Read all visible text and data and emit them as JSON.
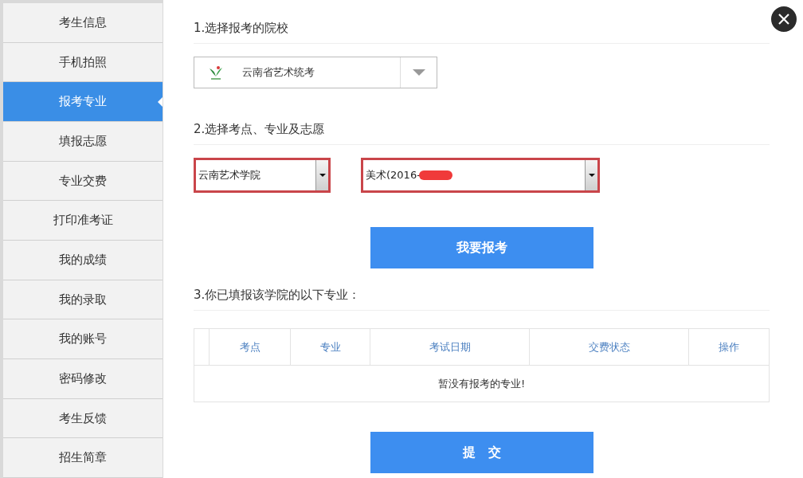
{
  "sidebar": {
    "items": [
      {
        "label": "考生信息",
        "selected": false
      },
      {
        "label": "手机拍照",
        "selected": false
      },
      {
        "label": "报考专业",
        "selected": true
      },
      {
        "label": "填报志愿",
        "selected": false
      },
      {
        "label": "专业交费",
        "selected": false
      },
      {
        "label": "打印准考证",
        "selected": false
      },
      {
        "label": "我的成绩",
        "selected": false
      },
      {
        "label": "我的录取",
        "selected": false
      },
      {
        "label": "我的账号",
        "selected": false
      },
      {
        "label": "密码修改",
        "selected": false
      },
      {
        "label": "考生反馈",
        "selected": false
      },
      {
        "label": "招生简章",
        "selected": false
      }
    ]
  },
  "section_1": {
    "title": "1.选择报考的院校",
    "school_select": {
      "value": "云南省艺术统考"
    }
  },
  "section_2": {
    "title": "2.选择考点、专业及志愿",
    "exam_site_select": {
      "value": "云南艺术学院"
    },
    "major_select": {
      "value": "美术(2016-",
      "redacted": true
    },
    "apply_button": "我要报考"
  },
  "section_3": {
    "title": "3.你已填报该学院的以下专业：",
    "table": {
      "columns": [
        "考点",
        "专业",
        "考试日期",
        "交费状态",
        "操作"
      ],
      "empty_message": "暂没有报考的专业!"
    }
  },
  "submit_button": "提　交"
}
